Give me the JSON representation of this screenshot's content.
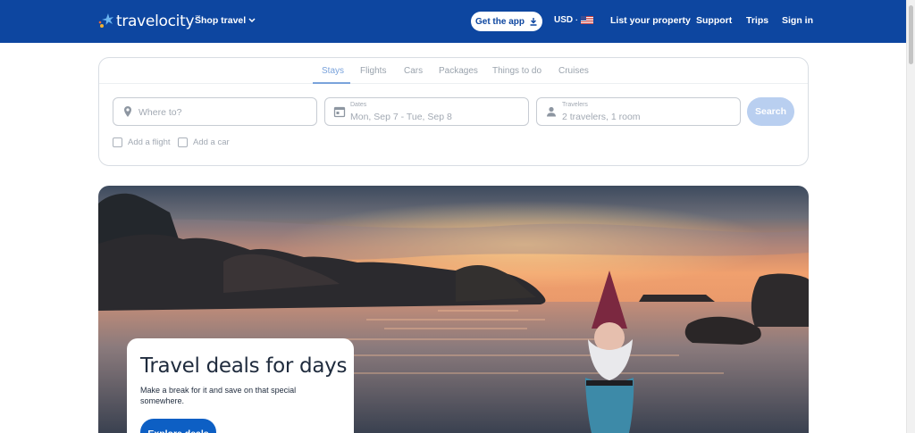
{
  "header": {
    "logo_text": "travelocity",
    "shop_travel": "Shop travel",
    "get_app": "Get the app",
    "currency": "USD",
    "nav": [
      "List your property",
      "Support",
      "Trips",
      "Sign in"
    ],
    "colors": {
      "bar": "#0d46a0",
      "text": "#ffffff"
    }
  },
  "search": {
    "tabs": [
      "Stays",
      "Flights",
      "Cars",
      "Packages",
      "Things to do",
      "Cruises"
    ],
    "active_tab": "Stays",
    "destination": {
      "placeholder": "Where to?",
      "icon": "location-pin-icon"
    },
    "dates": {
      "label": "Dates",
      "value": "Mon, Sep 7 - Tue, Sep 8",
      "icon": "calendar-icon"
    },
    "travelers": {
      "label": "Travelers",
      "value": "2 travelers, 1 room",
      "icon": "person-icon"
    },
    "search_button": "Search",
    "options": [
      "Add a flight",
      "Add a car"
    ]
  },
  "hero": {
    "title": "Travel deals for days",
    "subtitle": "Make a break for it and save on that special somewhere.",
    "button": "Explore deals"
  }
}
